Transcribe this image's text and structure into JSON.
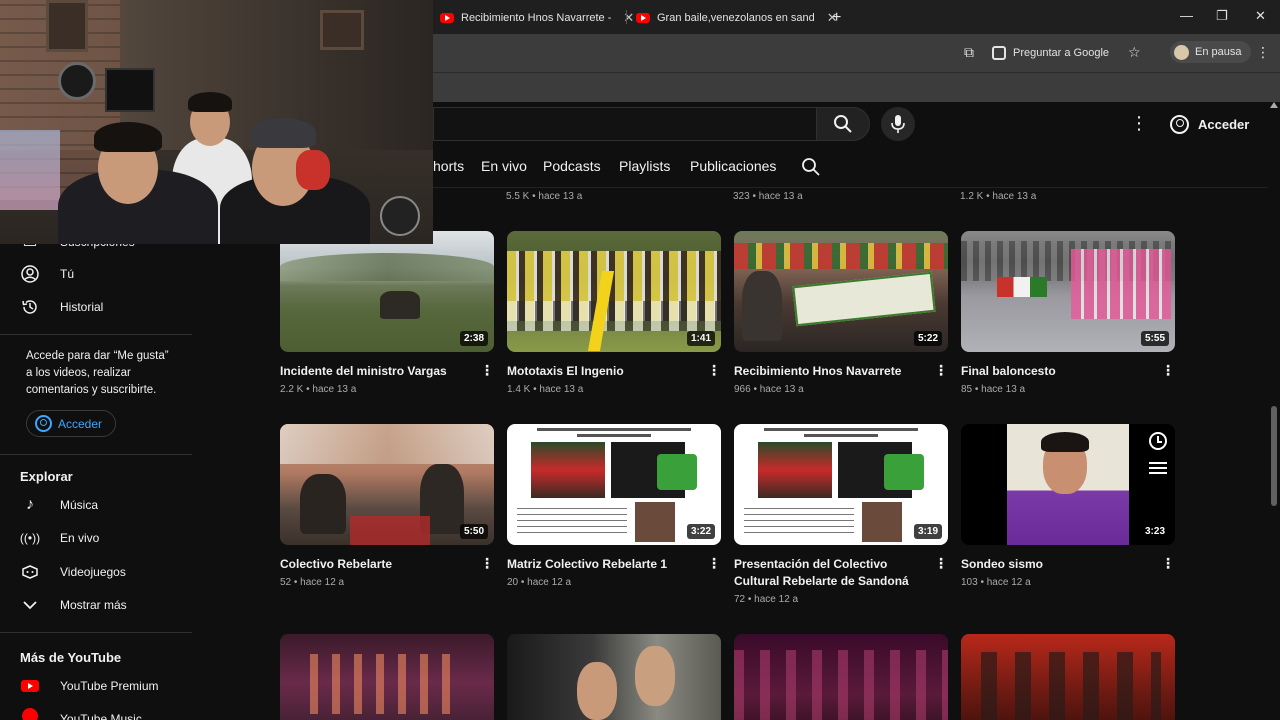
{
  "browser": {
    "tabs": [
      {
        "title": "Recibimiento Hnos Navarrete -"
      },
      {
        "title": "Gran baile,venezolanos en sand"
      }
    ],
    "new_tab": "+",
    "ask_google": "Preguntar a Google",
    "profile_status": "En pausa"
  },
  "header": {
    "signin_label": "Acceder"
  },
  "channel_tabs": [
    {
      "label": "horts"
    },
    {
      "label": "En vivo"
    },
    {
      "label": "Podcasts"
    },
    {
      "label": "Playlists"
    },
    {
      "label": "Publicaciones"
    }
  ],
  "sidebar": {
    "top_partial": "Suscripciones",
    "items": [
      {
        "label": "Tú",
        "icon": "user-circle-icon"
      },
      {
        "label": "Historial",
        "icon": "history-icon"
      }
    ],
    "signin_note": "Accede para dar “Me gusta” a los videos, realizar comentarios y suscribirte.",
    "signin_button": "Acceder",
    "explore_title": "Explorar",
    "explore_items": [
      {
        "label": "Música",
        "icon": "music-note-icon"
      },
      {
        "label": "En vivo",
        "icon": "live-icon"
      },
      {
        "label": "Videojuegos",
        "icon": "gamepad-icon"
      },
      {
        "label": "Mostrar más",
        "icon": "chevron-down-icon"
      }
    ],
    "more_title": "Más de YouTube",
    "more_items": [
      {
        "label": "YouTube Premium",
        "icon": "youtube-premium-icon"
      },
      {
        "label": "YouTube Music",
        "icon": "youtube-music-icon"
      }
    ]
  },
  "top_partial_stats": [
    "5.5 K • hace 13 a",
    "323 • hace 13 a",
    "1.2 K • hace 13 a"
  ],
  "videos_row1": [
    {
      "title": "Incidente del ministro Vargas",
      "meta": "2.2 K • hace 13 a",
      "duration": "2:38"
    },
    {
      "title": "Mototaxis El Ingenio",
      "meta": "1.4 K • hace 13 a",
      "duration": "1:41"
    },
    {
      "title": "Recibimiento Hnos Navarrete",
      "meta": "966 • hace 13 a",
      "duration": "5:22"
    },
    {
      "title": "Final baloncesto",
      "meta": "85 • hace 13 a",
      "duration": "5:55"
    }
  ],
  "videos_row2": [
    {
      "title": "Colectivo Rebelarte",
      "meta": "52 • hace 12 a",
      "duration": "5:50"
    },
    {
      "title": "Matriz Colectivo Rebelarte 1",
      "meta": "20 • hace 12 a",
      "duration": "3:22"
    },
    {
      "title": "Presentación del Colectivo Cultural Rebelarte de Sandoná",
      "meta": "72 • hace 12 a",
      "duration": "3:19"
    },
    {
      "title": "Sondeo sismo",
      "meta": "103 • hace 12 a",
      "duration": "3:23"
    }
  ],
  "colors": {
    "background": "#0f0f0f",
    "accent_blue": "#3ea6ff",
    "youtube_red": "#ff0000",
    "meta_gray": "#aaaaaa"
  }
}
